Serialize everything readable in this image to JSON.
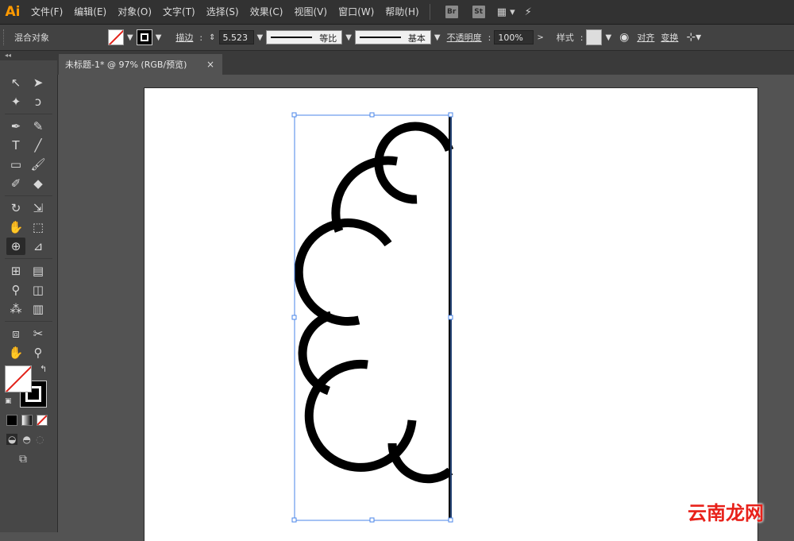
{
  "app": {
    "logo": "Ai"
  },
  "menu": [
    "文件(F)",
    "编辑(E)",
    "对象(O)",
    "文字(T)",
    "选择(S)",
    "效果(C)",
    "视图(V)",
    "窗口(W)",
    "帮助(H)"
  ],
  "menu_apps": [
    "Br",
    "St"
  ],
  "control": {
    "selection_label": "混合对象",
    "stroke_label": "描边",
    "stroke_weight": "5.523",
    "profile_label": "等比",
    "brush_label": "基本",
    "opacity_label": "不透明度",
    "opacity_value": "100%",
    "style_label": "样式",
    "align_label": "对齐",
    "transform_label": "变换"
  },
  "document": {
    "tab_title": "未标题-1* @ 97% (RGB/预览)",
    "close_glyph": "×"
  },
  "tools": [
    [
      "selection-tool-icon",
      "direct-selection-tool-icon"
    ],
    [
      "magic-wand-tool-icon",
      "lasso-tool-icon"
    ],
    [
      "pen-tool-icon",
      "curvature-tool-icon"
    ],
    [
      "type-tool-icon",
      "line-segment-tool-icon"
    ],
    [
      "rectangle-tool-icon",
      "paintbrush-tool-icon"
    ],
    [
      "shaper-tool-icon",
      "eraser-tool-icon"
    ],
    [
      "rotate-tool-icon",
      "scale-tool-icon"
    ],
    [
      "puppet-warp-tool-icon",
      "free-transform-tool-icon"
    ],
    [
      "shape-builder-tool-icon",
      "perspective-grid-tool-icon"
    ],
    [
      "mesh-tool-icon",
      "gradient-tool-icon"
    ],
    [
      "eyedropper-tool-icon",
      "blend-tool-icon"
    ],
    [
      "symbol-sprayer-tool-icon",
      "column-graph-tool-icon"
    ],
    [
      "artboard-tool-icon",
      "slice-tool-icon"
    ],
    [
      "hand-tool-icon",
      "zoom-tool-icon"
    ]
  ],
  "watermark": "云南龙网"
}
